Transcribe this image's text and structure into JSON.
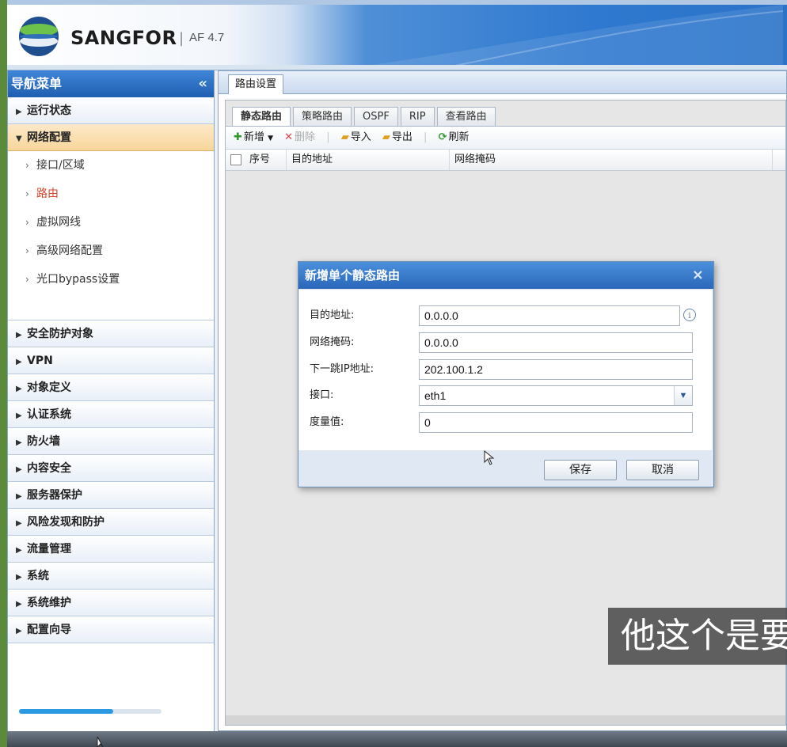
{
  "header": {
    "brand": "SANGFOR",
    "separator": "|",
    "version": "AF 4.7"
  },
  "sidebar": {
    "title": "导航菜单",
    "collapse_glyph": "«",
    "items_top": [
      {
        "label": "运行状态"
      },
      {
        "label": "网络配置",
        "open": true
      }
    ],
    "sub_items": [
      {
        "label": "接口/区域"
      },
      {
        "label": "路由",
        "active": true
      },
      {
        "label": "虚拟网线"
      },
      {
        "label": "高级网络配置"
      },
      {
        "label": "光口bypass设置"
      }
    ],
    "items_bottom": [
      {
        "label": "安全防护对象"
      },
      {
        "label": "VPN"
      },
      {
        "label": "对象定义"
      },
      {
        "label": "认证系统"
      },
      {
        "label": "防火墙"
      },
      {
        "label": "内容安全"
      },
      {
        "label": "服务器保护"
      },
      {
        "label": "风险发现和防护"
      },
      {
        "label": "流量管理"
      },
      {
        "label": "系统"
      },
      {
        "label": "系统维护"
      },
      {
        "label": "配置向导"
      }
    ],
    "scroll_progress": 0.66
  },
  "main": {
    "tab": "路由设置",
    "subtabs": [
      "静态路由",
      "策略路由",
      "OSPF",
      "RIP",
      "查看路由"
    ],
    "active_subtab": "静态路由",
    "toolbar": {
      "add": "新增",
      "delete": "删除",
      "import": "导入",
      "export": "导出",
      "refresh": "刷新"
    },
    "grid_columns": [
      "序号",
      "目的地址",
      "网络掩码"
    ]
  },
  "dialog": {
    "title": "新增单个静态路由",
    "close_glyph": "×",
    "fields": [
      {
        "label": "目的地址:",
        "value": "0.0.0.0"
      },
      {
        "label": "网络掩码:",
        "value": "0.0.0.0"
      },
      {
        "label": "下一跳IP地址:",
        "value": "202.100.1.2"
      },
      {
        "label": "接口:",
        "value": "eth1"
      },
      {
        "label": "度量值:",
        "value": "0"
      }
    ],
    "info_glyph": "i",
    "save": "保存",
    "cancel": "取消"
  },
  "subtitle": "他这个是要",
  "colors": {
    "accent": "#2f79d0",
    "nav_open": "#f7d69a",
    "active_link": "#d4432c"
  }
}
